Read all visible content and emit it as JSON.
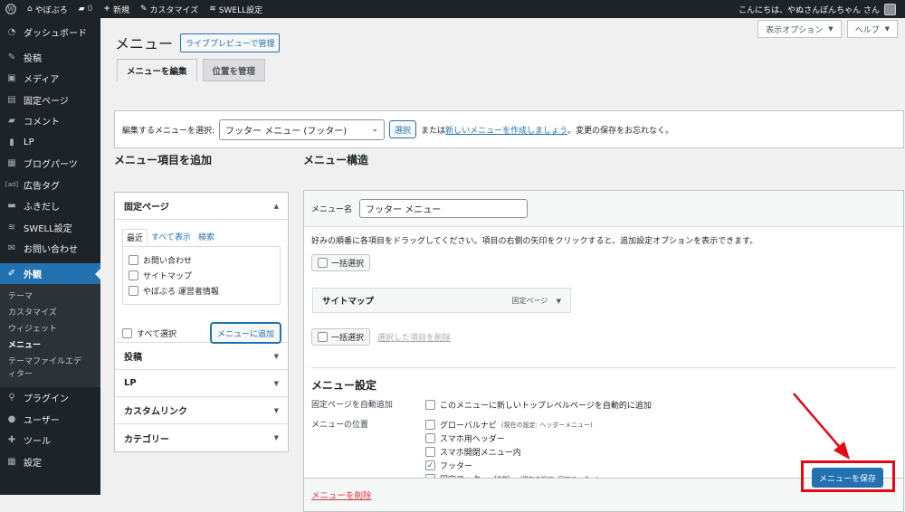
{
  "admin_bar": {
    "site_name": "やぼぶろ",
    "comments_count": "0",
    "new_label": "新規",
    "customize_label": "カスタマイズ",
    "swell_label": "SWELL設定",
    "greeting": "こんにちは、やぬさんぽんちゃん さん"
  },
  "sidebar": {
    "items": [
      {
        "label": "ダッシュボード",
        "icon": "dashboard-icon"
      },
      {
        "label": "投稿",
        "icon": "pin-icon"
      },
      {
        "label": "メディア",
        "icon": "media-icon"
      },
      {
        "label": "固定ページ",
        "icon": "page-icon"
      },
      {
        "label": "コメント",
        "icon": "comment-icon"
      },
      {
        "label": "LP",
        "icon": "document-icon"
      },
      {
        "label": "ブログパーツ",
        "icon": "grid-icon"
      },
      {
        "label": "広告タグ",
        "icon": "ad-icon"
      },
      {
        "label": "ふきだし",
        "icon": "bubble-icon"
      },
      {
        "label": "SWELL設定",
        "icon": "swell-icon"
      },
      {
        "label": "お問い合わせ",
        "icon": "mail-icon"
      },
      {
        "label": "外観",
        "icon": "brush-icon"
      }
    ],
    "submenu": [
      "テーマ",
      "カスタマイズ",
      "ウィジェット",
      "メニュー",
      "テーマファイルエディター"
    ],
    "bottom_items": [
      {
        "label": "プラグイン",
        "icon": "plugin-icon"
      },
      {
        "label": "ユーザー",
        "icon": "user-icon"
      },
      {
        "label": "ツール",
        "icon": "wrench-icon"
      },
      {
        "label": "設定",
        "icon": "settings-icon"
      }
    ]
  },
  "screen_options": {
    "display_options": "表示オプション",
    "help": "ヘルプ"
  },
  "page": {
    "title": "メニュー",
    "live_preview": "ライブプレビューで管理",
    "tabs": [
      "メニューを編集",
      "位置を管理"
    ]
  },
  "select_bar": {
    "label": "編集するメニューを選択:",
    "selected_menu": "フッター メニュー (フッター)",
    "select_button": "選択",
    "or_text": "または",
    "create_link": "新しいメニューを作成しましょう",
    "suffix_text": "。変更の保存をお忘れなく。"
  },
  "add_items": {
    "heading": "メニュー項目を追加",
    "fixed_pages_title": "固定ページ",
    "inner_tabs": [
      "最近",
      "すべて表示",
      "検索"
    ],
    "pages": [
      "お問い合わせ",
      "サイトマップ",
      "やぼぶろ 運営者情報"
    ],
    "select_all": "すべて選択",
    "add_button": "メニューに追加",
    "other_sections": [
      "投稿",
      "LP",
      "カスタムリンク",
      "カテゴリー"
    ]
  },
  "structure": {
    "heading": "メニュー構造",
    "name_label": "メニュー名",
    "name_value": "フッター メニュー",
    "instructions": "好みの順番に各項目をドラッグしてください。項目の右側の矢印をクリックすると、追加設定オプションを表示できます。",
    "bulk_select": "一括選択",
    "item_title": "サイトマップ",
    "item_type": "固定ページ",
    "remove_selected": "選択した項目を削除"
  },
  "settings": {
    "heading": "メニュー設定",
    "auto_add_label": "固定ページを自動追加",
    "auto_add_option": "このメニューに新しいトップレベルページを自動的に追加",
    "location_label": "メニューの位置",
    "locations": [
      {
        "name": "グローバルナビ",
        "note": "(現在の設定: ヘッダーメニュー)",
        "checked": false
      },
      {
        "name": "スマホ用ヘッダー",
        "note": "",
        "checked": false
      },
      {
        "name": "スマホ開閉メニュー内",
        "note": "",
        "checked": false
      },
      {
        "name": "フッター",
        "note": "",
        "checked": true
      },
      {
        "name": "固定フッター（SP）",
        "note": "(現在の設定: 固定フッター)",
        "checked": false
      }
    ]
  },
  "footer": {
    "delete_menu": "メニューを削除",
    "save_menu": "メニューを保存"
  }
}
